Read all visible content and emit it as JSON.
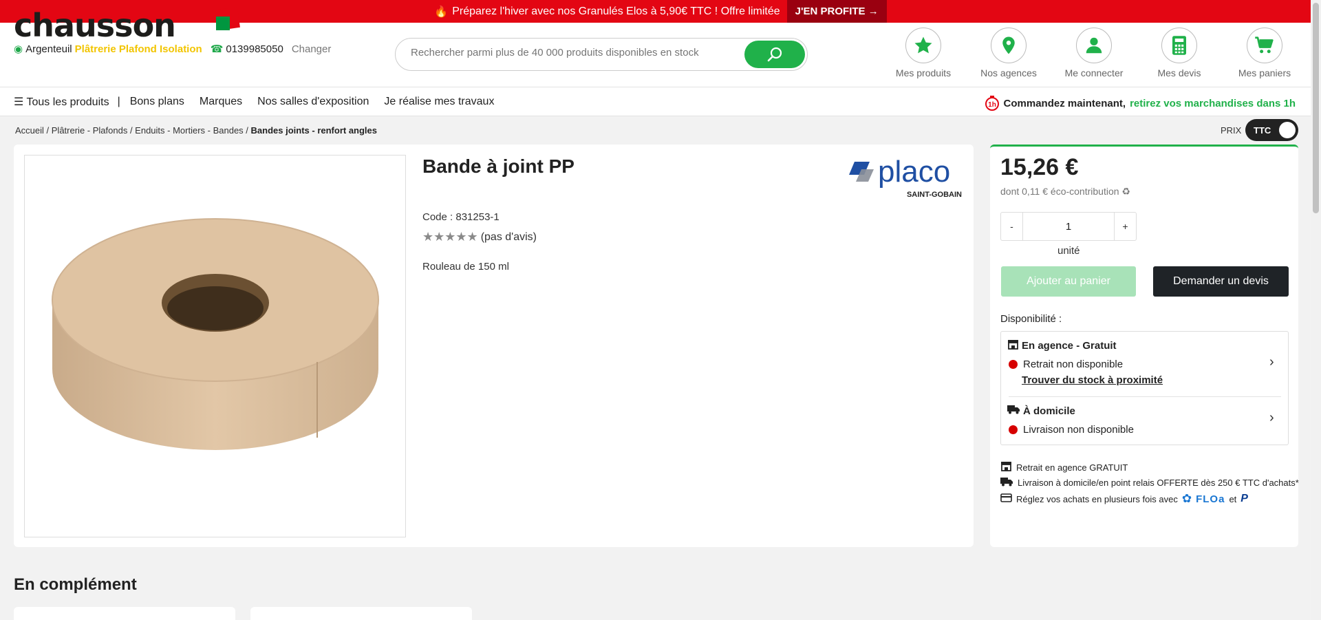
{
  "promo": {
    "text": "Préparez l'hiver avec nos Granulés Elos à 5,90€ TTC ! Offre limitée",
    "cta": "J'EN PROFITE"
  },
  "header": {
    "logo": "chausson",
    "city": "Argenteuil",
    "store": "Plâtrerie Plafond Isolation",
    "phone": "0139985050",
    "change": "Changer",
    "search_placeholder": "Rechercher parmi plus de 40 000 produits disponibles en stock",
    "icons": [
      {
        "label": "Mes produits",
        "icon": "star-icon"
      },
      {
        "label": "Nos agences",
        "icon": "map-pin-icon"
      },
      {
        "label": "Me connecter",
        "icon": "user-icon"
      },
      {
        "label": "Mes devis",
        "icon": "calculator-icon"
      },
      {
        "label": "Mes paniers",
        "icon": "cart-icon"
      }
    ]
  },
  "nav": {
    "all_products": "Tous les produits",
    "separator": "|",
    "items": [
      "Bons plans",
      "Marques",
      "Nos salles d'exposition",
      "Je réalise mes travaux"
    ],
    "promo_bold": "Commandez maintenant,",
    "promo_green": "retirez vos marchandises dans 1h"
  },
  "breadcrumb": {
    "items": [
      "Accueil",
      "Plâtrerie - Plafonds",
      "Enduits - Mortiers - Bandes"
    ],
    "current": "Bandes joints - renfort angles",
    "sep": " / "
  },
  "price_toggle": {
    "label": "PRIX",
    "value": "TTC"
  },
  "product": {
    "title": "Bande à joint PP",
    "brand": "placo",
    "brand_sub": "SAINT-GOBAIN",
    "code": "Code : 831253-1",
    "rating_stars": 0,
    "reviews": "(pas d'avis)",
    "description": "Rouleau de 150 ml"
  },
  "buy": {
    "price": "15,26 €",
    "eco": "dont 0,11 € éco-contribution",
    "qty_minus": "-",
    "qty": "1",
    "qty_plus": "+",
    "unit": "unité",
    "add_to_cart": "Ajouter au panier",
    "request_quote": "Demander un devis",
    "availability_label": "Disponibilité :",
    "store_title": "En agence - Gratuit",
    "store_status": "Retrait non disponible",
    "store_link": "Trouver du stock à proximité",
    "home_title": "À domicile",
    "home_status": "Livraison non disponible",
    "info1": "Retrait en agence GRATUIT",
    "info2": "Livraison à domicile/en point relais OFFERTE dès 250 € TTC d'achats*",
    "info3": "Réglez vos achats en plusieurs fois avec",
    "floa": "FLOa",
    "et": "et",
    "paypal": "P",
    "status_color": "#d60000",
    "accent": "#20b14a"
  },
  "section": {
    "complement": "En complément"
  }
}
